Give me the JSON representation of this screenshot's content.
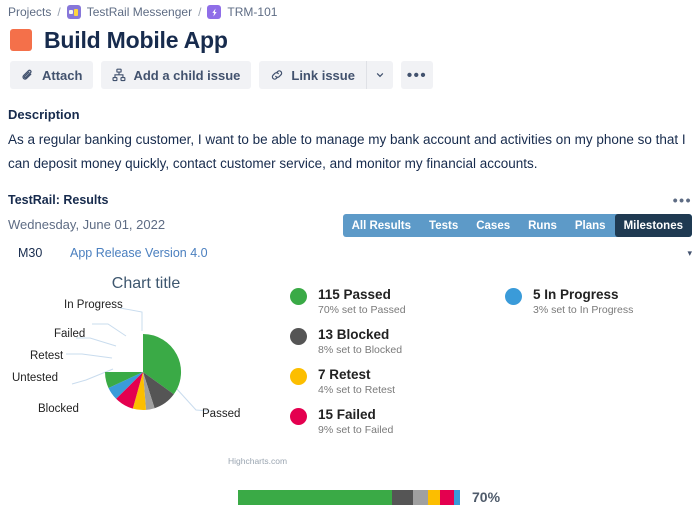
{
  "breadcrumb": {
    "project_link": "Projects",
    "separator": "/",
    "board_link": "TestRail Messenger",
    "issue_key": "TRM-101",
    "board_icon": "project-avatar-icon",
    "issue_icon": "story-lightning-icon"
  },
  "header": {
    "title": "Build Mobile App",
    "swatch_color": "#f4704a"
  },
  "toolbar": {
    "attach_label": "Attach",
    "child_issue_label": "Add a child issue",
    "link_issue_label": "Link issue",
    "caret_label": "⌄",
    "more_label": "•••"
  },
  "description": {
    "label": "Description",
    "text": "As a regular banking customer, I want to be able to manage my bank account and activities on my phone so that I can deposit money quickly, contact customer service, and monitor my financial accounts."
  },
  "testrail": {
    "panel_title": "TestRail: Results",
    "panel_more": "•••",
    "date": "Wednesday, June 01, 2022",
    "tabs": [
      {
        "label": "All Results",
        "active": false
      },
      {
        "label": "Tests",
        "active": false
      },
      {
        "label": "Cases",
        "active": false
      },
      {
        "label": "Runs",
        "active": false
      },
      {
        "label": "Plans",
        "active": false
      },
      {
        "label": "Milestones",
        "active": true
      }
    ],
    "milestone_code": "M30",
    "milestone_link": "App Release Version 4.0",
    "milestone_caret": "▾",
    "tab_bg": "#5d9ac8",
    "tab_active_bg": "#1f3a52"
  },
  "chart_data": {
    "type": "pie",
    "title": "Chart title",
    "credits": "Highcharts.com",
    "categories": [
      "Passed",
      "Blocked",
      "Untested",
      "Retest",
      "Failed",
      "In Progress"
    ],
    "values": [
      115,
      13,
      6,
      7,
      15,
      5
    ],
    "percents": [
      70,
      8,
      4,
      4,
      9,
      3
    ],
    "colors": [
      "#3aaa46",
      "#555555",
      "#a0a0a0",
      "#fcbe00",
      "#e4004f",
      "#3a9bd9"
    ],
    "labels": [
      "Passed",
      "Blocked",
      "Untested",
      "Retest",
      "Failed",
      "In Progress"
    ],
    "legend_position": "right"
  },
  "legend": {
    "column_1": [
      {
        "count_label": "115 Passed",
        "sub": "70% set to Passed",
        "color": "#3aaa46"
      },
      {
        "count_label": "13 Blocked",
        "sub": "8% set to Blocked",
        "color": "#555555"
      },
      {
        "count_label": "7 Retest",
        "sub": "4% set to Retest",
        "color": "#fcbe00"
      },
      {
        "count_label": "15 Failed",
        "sub": "9% set to Failed",
        "color": "#e4004f"
      }
    ],
    "column_2": [
      {
        "count_label": "5 In Progress",
        "sub": "3% set to In Progress",
        "color": "#3a9bd9"
      }
    ]
  },
  "progress": {
    "percent_label": "70%",
    "segments": [
      {
        "name": "Passed",
        "width_pct": 69.5,
        "color": "#3aaa46"
      },
      {
        "name": "Blocked",
        "width_pct": 9.5,
        "color": "#555555"
      },
      {
        "name": "Untested",
        "width_pct": 6.5,
        "color": "#a0a0a0"
      },
      {
        "name": "Retest",
        "width_pct": 5.5,
        "color": "#fcbe00"
      },
      {
        "name": "Failed",
        "width_pct": 6.5,
        "color": "#e4004f"
      },
      {
        "name": "In Progress",
        "width_pct": 2.5,
        "color": "#3a9bd9"
      }
    ]
  }
}
